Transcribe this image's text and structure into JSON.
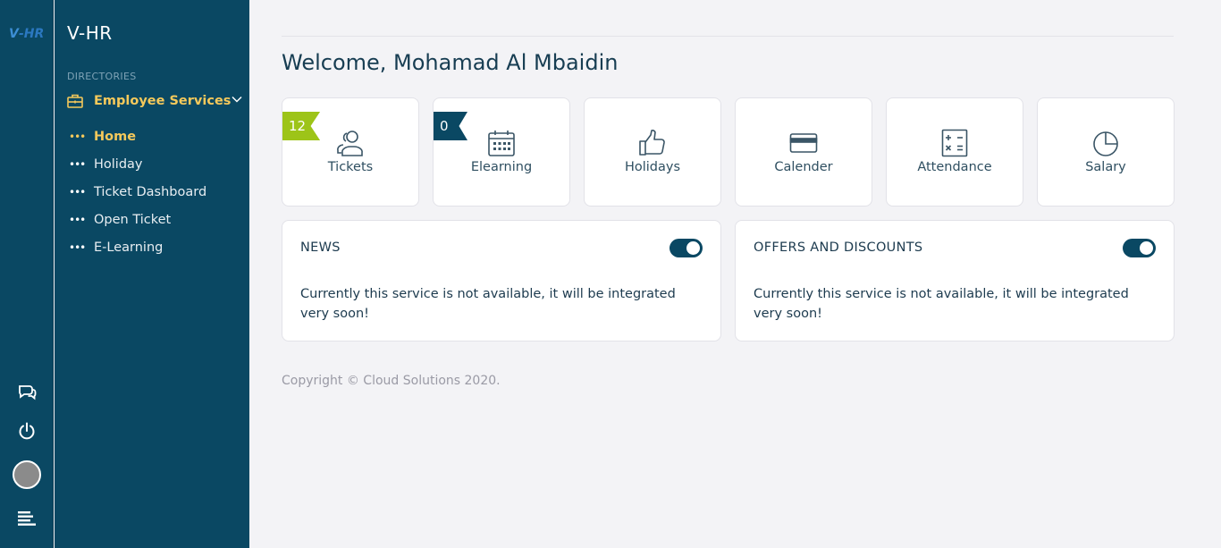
{
  "app": {
    "brand": "V-HR",
    "logo_text": "V-HR"
  },
  "sidebar": {
    "section_label": "DIRECTORIES",
    "group_label": "Employee Services",
    "items": [
      {
        "label": "Home",
        "active": true
      },
      {
        "label": "Holiday",
        "active": false
      },
      {
        "label": "Ticket Dashboard",
        "active": false
      },
      {
        "label": "Open Ticket",
        "active": false
      },
      {
        "label": "E-Learning",
        "active": false
      }
    ]
  },
  "rail": {
    "icons": [
      "chat-icon",
      "power-icon",
      "avatar",
      "menu-icon"
    ]
  },
  "main": {
    "welcome": "Welcome, Mohamad Al Mbaidin",
    "tiles": [
      {
        "label": "Tickets",
        "icon": "users-icon",
        "badge": "12",
        "badge_color": "#9dc418"
      },
      {
        "label": "Elearning",
        "icon": "calendar-icon",
        "badge": "0",
        "badge_color": "#0a4863"
      },
      {
        "label": "Holidays",
        "icon": "thumbs-up-icon"
      },
      {
        "label": "Calender",
        "icon": "credit-card-icon"
      },
      {
        "label": "Attendance",
        "icon": "calculator-icon"
      },
      {
        "label": "Salary",
        "icon": "pie-chart-icon"
      }
    ],
    "cards": [
      {
        "title": "NEWS",
        "body": "Currently this service is not available, it will be integrated very soon!",
        "toggle_on": true
      },
      {
        "title": "OFFERS AND DISCOUNTS",
        "body": "Currently this service is not available, it will be integrated very soon!",
        "toggle_on": true
      }
    ],
    "copyright": "Copyright © Cloud Solutions 2020."
  },
  "colors": {
    "sidebar_bg": "#0a4863",
    "accent_yellow": "#f5c95b",
    "badge_green": "#9dc418",
    "page_bg": "#f3f3f6"
  }
}
